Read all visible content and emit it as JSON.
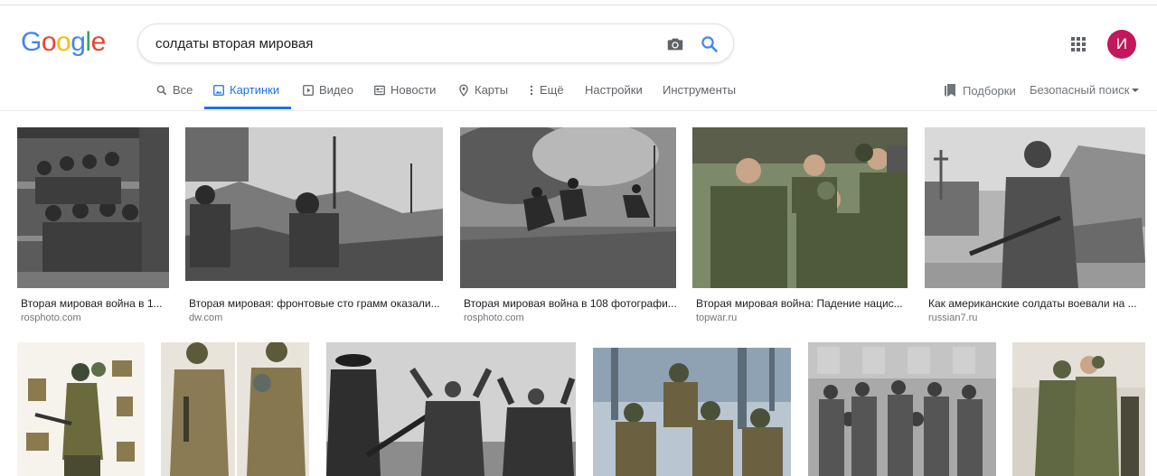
{
  "logo": {
    "letters": [
      "G",
      "o",
      "o",
      "g",
      "l",
      "e"
    ],
    "colors": [
      "#4285f4",
      "#ea4335",
      "#fbbc05",
      "#4285f4",
      "#34a853",
      "#ea4335"
    ]
  },
  "search": {
    "query": "солдаты вторая мировая"
  },
  "account": {
    "initial": "И",
    "color": "#c2185b"
  },
  "tabs": {
    "all": "Все",
    "images": "Картинки",
    "video": "Видео",
    "news": "Новости",
    "maps": "Карты",
    "more": "Ещё",
    "settings": "Настройки",
    "tools": "Инструменты"
  },
  "right_links": {
    "collections": "Подборки",
    "safe_search": "Безопасный поиск"
  },
  "colors": {
    "accent": "#1a73e8",
    "text": "#202124",
    "muted": "#70757a"
  },
  "results_row1": [
    {
      "title": "Вторая мировая война в 1...",
      "site": "rosphoto.com"
    },
    {
      "title": "Вторая мировая: фронтовые сто грамм оказали...",
      "site": "dw.com"
    },
    {
      "title": "Вторая мировая война в 108 фотографи...",
      "site": "rosphoto.com"
    },
    {
      "title": "Вторая мировая война: Падение нацис...",
      "site": "topwar.ru"
    },
    {
      "title": "Как американские солдаты воевали на ...",
      "site": "russian7.ru"
    }
  ]
}
